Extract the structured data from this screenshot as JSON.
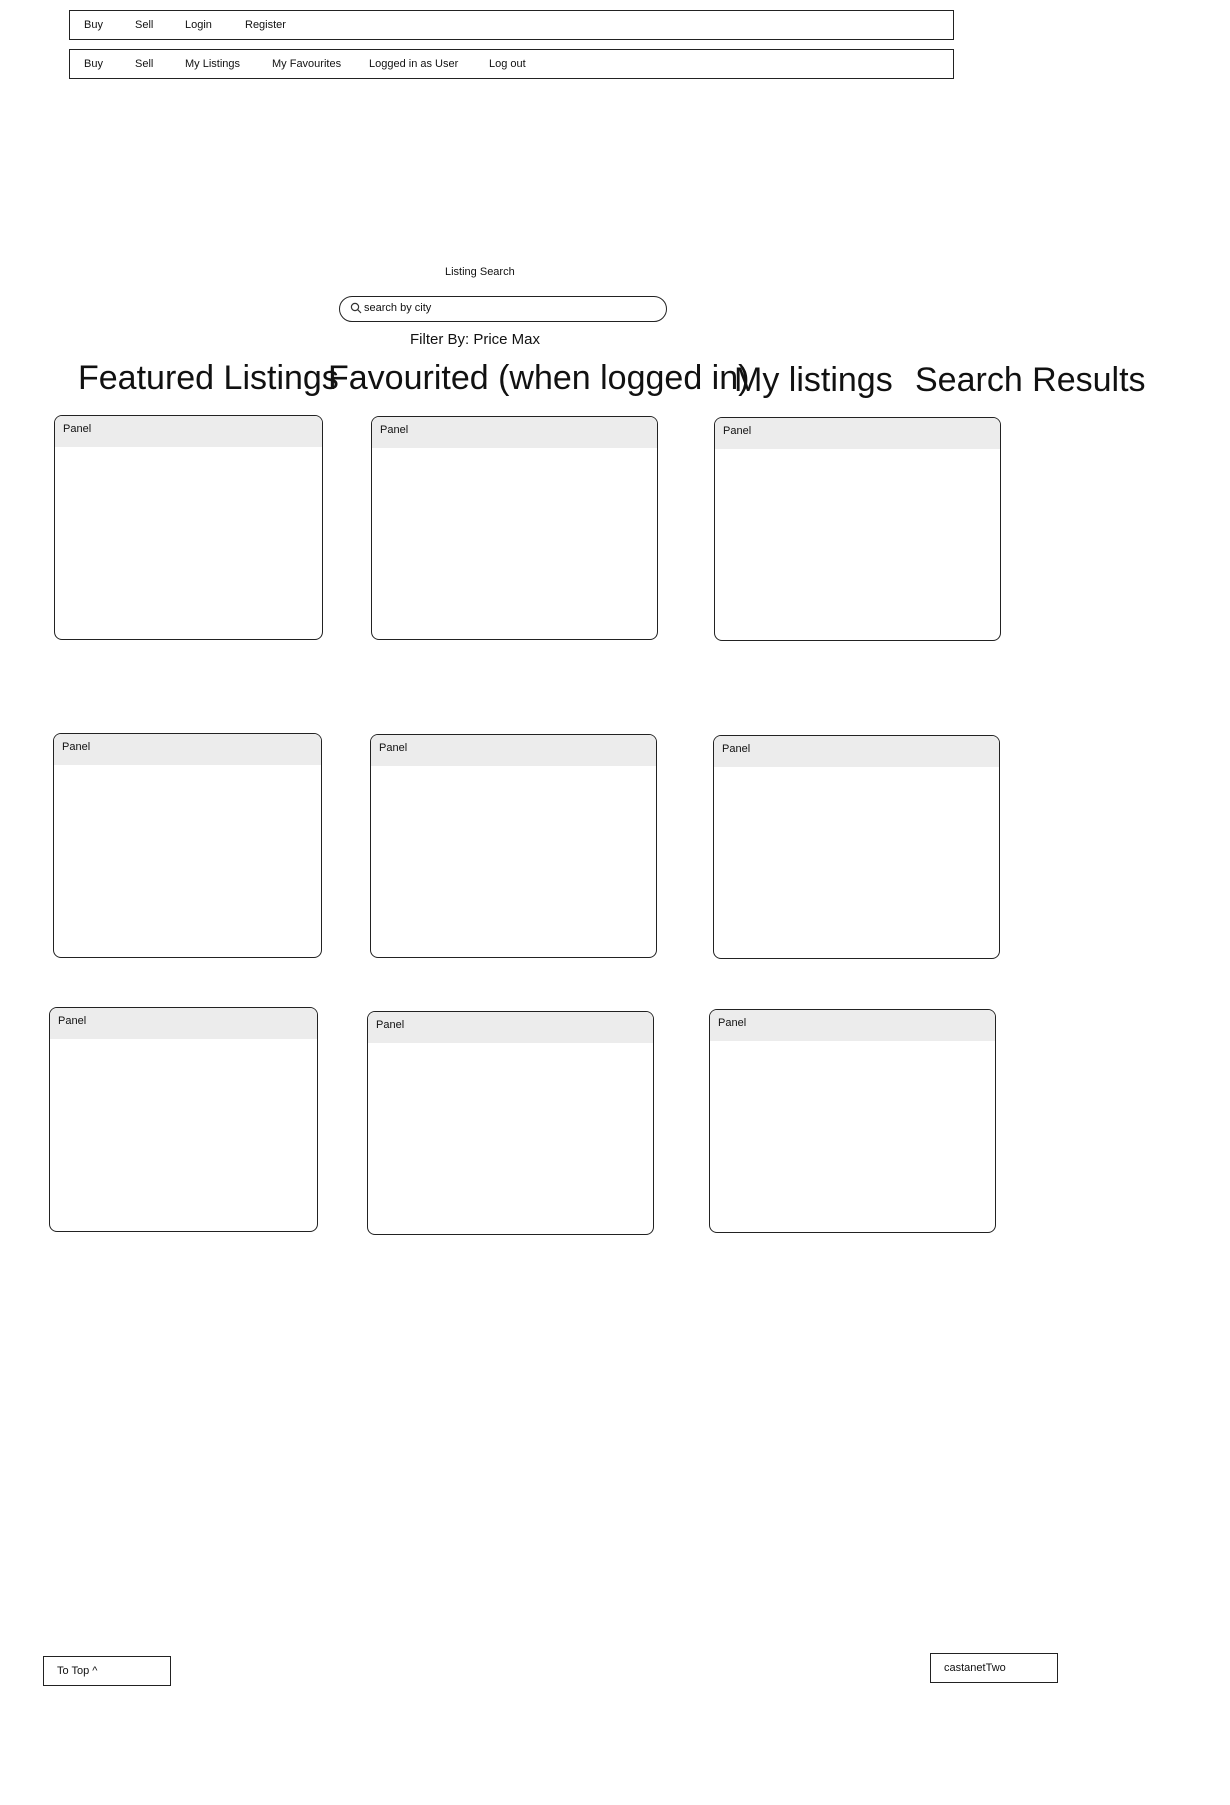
{
  "nav_guest": {
    "items": [
      "Buy",
      "Sell",
      "Login",
      "Register"
    ]
  },
  "nav_user": {
    "items": [
      "Buy",
      "Sell",
      "My Listings",
      "My Favourites",
      "Logged in as User",
      "Log out"
    ]
  },
  "search": {
    "caption": "Listing Search",
    "placeholder": "search by city",
    "filter": "Filter By: Price Max"
  },
  "headings": [
    "Featured Listings",
    "Favourited (when logged in)",
    "My listings",
    "Search Results"
  ],
  "panels": {
    "header": "Panel"
  },
  "footer": {
    "to_top": "To Top ^",
    "brand": "castanetTwo"
  }
}
